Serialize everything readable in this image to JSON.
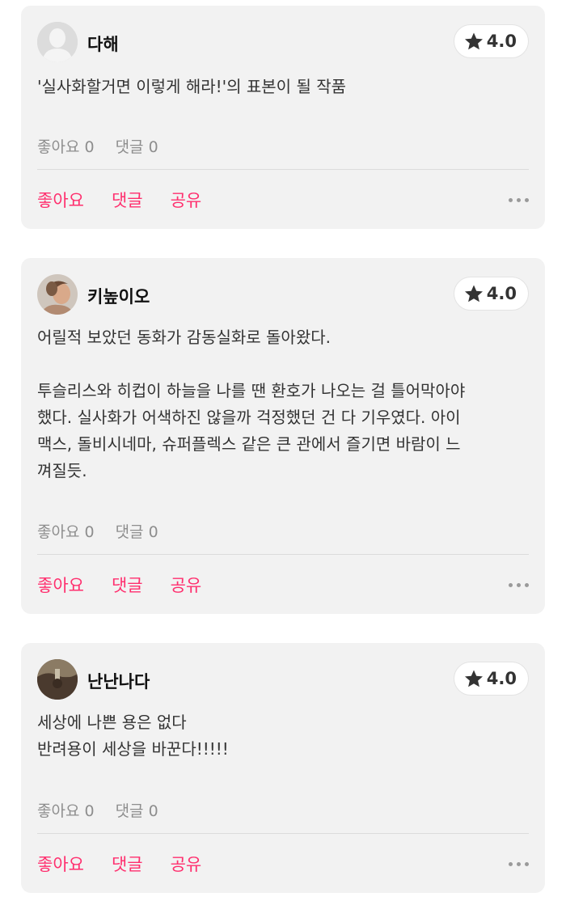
{
  "reviews": [
    {
      "username": "다해",
      "avatar": "default-person-avatar",
      "rating": "4.0",
      "text": "'실사화할거면 이렇게 해라!'의 표본이 될 작품",
      "likes_stat": "좋아요 0",
      "comments_stat": "댓글 0"
    },
    {
      "username": "키높이오",
      "avatar": "photo-avatar",
      "rating": "4.0",
      "text": "어릴적 보았던 동화가 감동실화로 돌아왔다.\n\n투슬리스와 히컵이 하늘을 나를 땐 환호가 나오는 걸 틀어막아야\n했다. 실사화가 어색하진 않을까 걱정했던 건 다 기우였다. 아이\n맥스, 돌비시네마, 슈퍼플렉스 같은 큰 관에서 즐기면 바람이 느\n껴질듯.",
      "likes_stat": "좋아요 0",
      "comments_stat": "댓글 0"
    },
    {
      "username": "난난나다",
      "avatar": "photo-avatar",
      "rating": "4.0",
      "text": "세상에 나쁜 용은 없다\n반려용이 세상을 바꾼다!!!!!",
      "likes_stat": "좋아요 0",
      "comments_stat": "댓글 0"
    }
  ],
  "actions": {
    "like": "좋아요",
    "comment": "댓글",
    "share": "공유"
  },
  "colors": {
    "accent": "#ff2f6e",
    "card_bg": "#f2f2f2"
  }
}
